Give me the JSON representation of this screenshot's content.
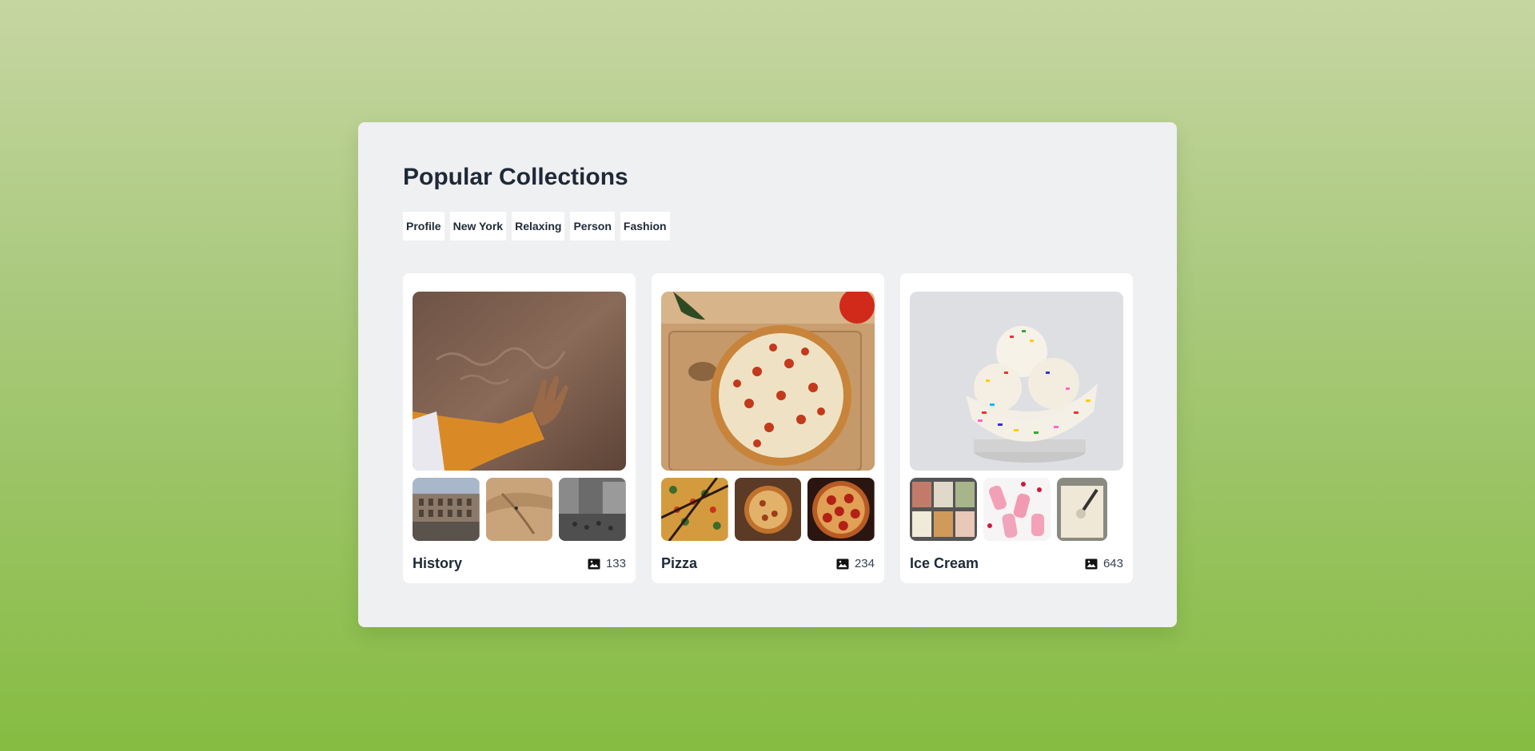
{
  "page": {
    "title": "Popular Collections"
  },
  "tags": [
    "Profile",
    "New York",
    "Relaxing",
    "Person",
    "Fashion"
  ],
  "collections": [
    {
      "name": "History",
      "count": "133",
      "images": [
        "hand-on-rock-carving-photo",
        "colosseum-photo",
        "desert-dunes-photo",
        "old-street-bw-photo"
      ]
    },
    {
      "name": "Pizza",
      "count": "234",
      "images": [
        "pizza-on-board-photo",
        "pizza-slice-cut-photo",
        "pizza-served-photo",
        "pepperoni-pizza-photo"
      ]
    },
    {
      "name": "Ice Cream",
      "count": "643",
      "images": [
        "ice-cream-sprinkle-bowl-photo",
        "ice-cream-tubs-photo",
        "pink-popsicles-photo",
        "vanilla-scoop-photo"
      ]
    }
  ],
  "icons": {
    "count": "image-icon"
  },
  "colors": {
    "accent_text": "#1f2937",
    "panel_bg": "#eff0f2"
  }
}
